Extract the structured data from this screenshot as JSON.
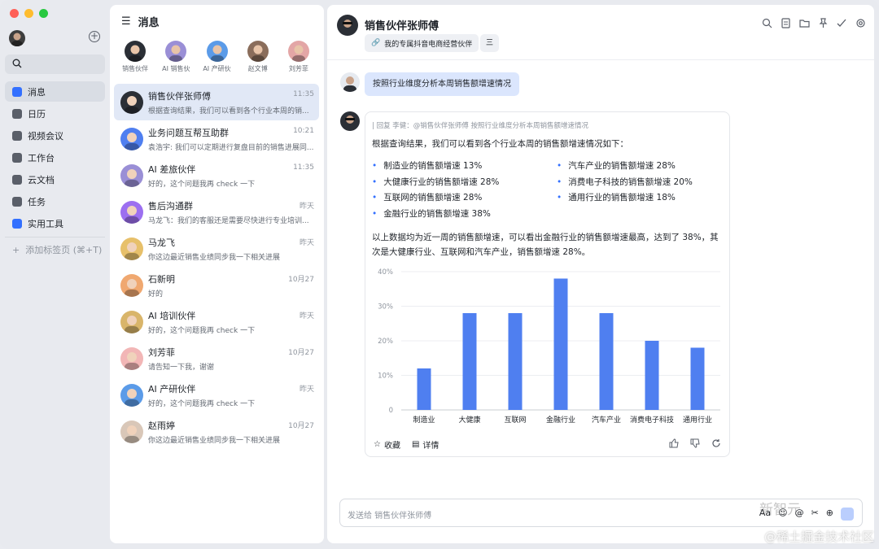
{
  "nav": {
    "items": [
      {
        "label": "消息",
        "icon": "message-icon",
        "color": "#3370ff",
        "active": true
      },
      {
        "label": "日历",
        "icon": "calendar-icon",
        "color": "#5a5f69"
      },
      {
        "label": "视频会议",
        "icon": "video-icon",
        "color": "#5a5f69"
      },
      {
        "label": "工作台",
        "icon": "workspace-icon",
        "color": "#5a5f69"
      },
      {
        "label": "云文档",
        "icon": "doc-icon",
        "color": "#5a5f69"
      },
      {
        "label": "任务",
        "icon": "task-icon",
        "color": "#5a5f69"
      },
      {
        "label": "实用工具",
        "icon": "tools-icon",
        "color": "#3370ff"
      }
    ],
    "add_tab": "添加标签页 (⌘+T)"
  },
  "list": {
    "title": "消息",
    "pins": [
      {
        "label": "销售伙伴",
        "color": "#2b2f36"
      },
      {
        "label": "AI 销售伙",
        "color": "#9a8fd6"
      },
      {
        "label": "AI 产研伙",
        "color": "#5b9be8"
      },
      {
        "label": "赵文博",
        "color": "#8a6d5b"
      },
      {
        "label": "刘芳菲",
        "color": "#e3a6a6"
      }
    ],
    "conversations": [
      {
        "name": "销售伙伴张师傅",
        "time": "11:35",
        "preview": "根据查询结果，我们可以看到各个行业本周的销...",
        "color": "#2b2f36",
        "active": true
      },
      {
        "name": "业务问题互帮互助群",
        "time": "10:21",
        "preview": "袁浩宇: 我们可以定期进行复盘目前的销售进展同...",
        "color": "#4f7ff0"
      },
      {
        "name": "AI 差旅伙伴",
        "time": "11:35",
        "preview": "好的，这个问题我再 check 一下",
        "color": "#9a8fd6"
      },
      {
        "name": "售后沟通群",
        "time": "昨天",
        "preview": "马龙飞：我们的客服还是需要尽快进行专业培训...",
        "color": "#9c6ff0"
      },
      {
        "name": "马龙飞",
        "time": "昨天",
        "preview": "你这边最近销售业绩同步我一下相关进展",
        "color": "#e7c06a"
      },
      {
        "name": "石新明",
        "time": "10月27",
        "preview": "好的",
        "color": "#f0a870"
      },
      {
        "name": "AI 培训伙伴",
        "time": "昨天",
        "preview": "好的，这个问题我再 check 一下",
        "color": "#d9b56a"
      },
      {
        "name": "刘芳菲",
        "time": "10月27",
        "preview": "请告知一下我，谢谢",
        "color": "#f2b6b6"
      },
      {
        "name": "AI 产研伙伴",
        "time": "昨天",
        "preview": "好的，这个问题我再 check 一下",
        "color": "#5b9be8"
      },
      {
        "name": "赵雨婷",
        "time": "10月27",
        "preview": "你这边最近销售业绩同步我一下相关进展",
        "color": "#d9c7b8"
      }
    ]
  },
  "chat": {
    "title": "销售伙伴张师傅",
    "tag": "我的专属抖音电商经营伙伴",
    "tag2": "三",
    "user_message": "按照行业维度分析本周销售额增速情况",
    "reply_quote": "| 回复 李健：@销售伙伴张师傅 按照行业维度分析本周销售额增速情况",
    "intro": "根据查询结果，我们可以看到各个行业本周的销售额增速情况如下：",
    "bullets": [
      "制造业的销售额增速 13%",
      "汽车产业的销售额增速 28%",
      "大健康行业的销售额增速 28%",
      "消费电子科技的销售额增速 20%",
      "互联网的销售额增速 28%",
      "通用行业的销售额增速 18%",
      "金融行业的销售额增速 38%"
    ],
    "summary": "以上数据均为近一周的销售额增速，可以看出金融行业的销售额增速最高，达到了 38%，其次是大健康行业、互联网和汽车产业，销售额增速 28%。",
    "foot_favorite": "收藏",
    "foot_detail": "详情",
    "composer_placeholder": "发送给 销售伙伴张师傅",
    "composer_aa": "Aa"
  },
  "chart_data": {
    "type": "bar",
    "categories": [
      "制造业",
      "大健康",
      "互联网",
      "金融行业",
      "汽车产业",
      "消费电子科技",
      "通用行业"
    ],
    "values": [
      12,
      28,
      28,
      38,
      28,
      20,
      18
    ],
    "yticks": [
      "0",
      "10%",
      "20%",
      "30%",
      "40%"
    ],
    "ylim": [
      0,
      40
    ],
    "color": "#4f7ff0",
    "grid": true
  },
  "watermark": "@稀土掘金技术社区",
  "watermark2": "新智元"
}
